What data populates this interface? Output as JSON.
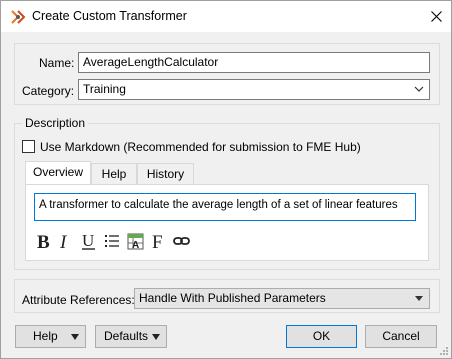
{
  "dialog": {
    "title": "Create Custom Transformer"
  },
  "form": {
    "name_label": "Name:",
    "name_value": "AverageLengthCalculator",
    "category_label": "Category:",
    "category_value": "Training"
  },
  "description": {
    "group_label": "Description",
    "markdown_label": "Use Markdown (Recommended for submission to FME Hub)",
    "markdown_checked": false,
    "tabs": [
      "Overview",
      "Help",
      "History"
    ],
    "active_tab": "Overview",
    "text": "A transformer to calculate the average length of a set of linear features",
    "toolbar_icons": [
      "bold-icon",
      "italic-icon",
      "underline-icon",
      "bullet-list-icon",
      "insert-attribute-icon",
      "font-icon",
      "link-icon"
    ]
  },
  "attributes": {
    "label": "Attribute References:",
    "value": "Handle With Published Parameters"
  },
  "buttons": {
    "help": "Help",
    "defaults": "Defaults",
    "ok": "OK",
    "cancel": "Cancel"
  }
}
